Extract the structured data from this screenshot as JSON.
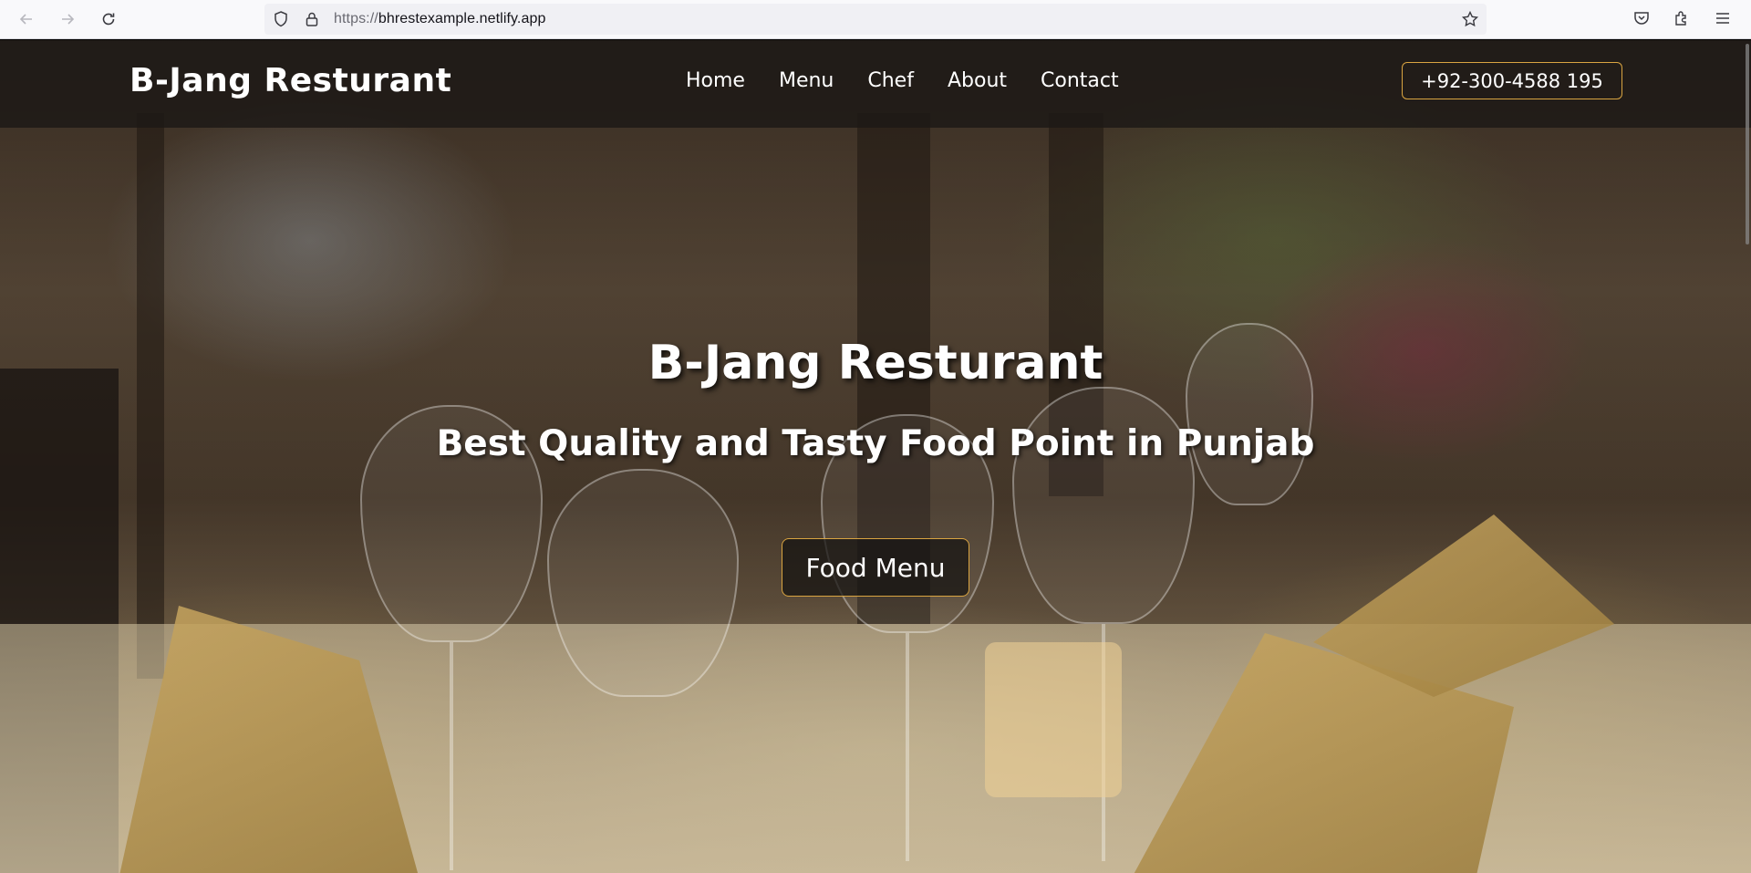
{
  "browser": {
    "url_prefix": "https://",
    "url_host": "bhrestexample.netlify.app"
  },
  "navbar": {
    "brand": "B-Jang Resturant",
    "menu": [
      "Home",
      "Menu",
      "Chef",
      "About",
      "Contact"
    ],
    "phone": "+92-300-4588 195"
  },
  "hero": {
    "title": "B-Jang Resturant",
    "subtitle": "Best Quality and Tasty Food Point in Punjab",
    "cta": "Food Menu"
  },
  "colors": {
    "accent": "#d9a441",
    "navbar_bg": "#1c1816",
    "text": "#ffffff"
  }
}
